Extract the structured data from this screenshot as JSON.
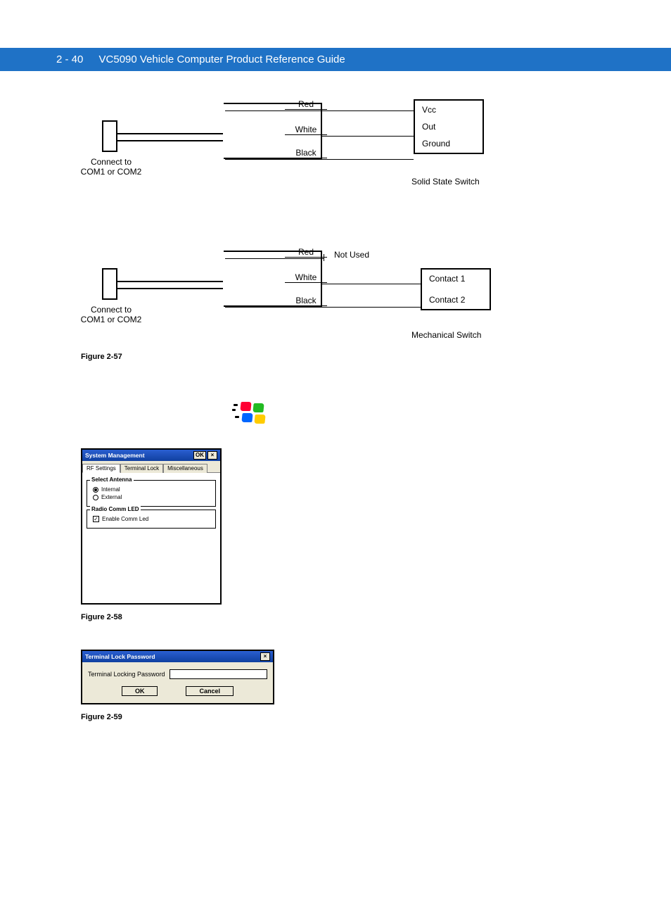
{
  "header": {
    "page_num": "2 - 40",
    "title": "VC5090 Vehicle Computer Product Reference Guide"
  },
  "diagram1": {
    "connect_label": "Connect to\nCOM1 or COM2",
    "wires": {
      "red": "Red",
      "white": "White",
      "black": "Black"
    },
    "box": {
      "line1": "Vcc",
      "line2": "Out",
      "line3": "Ground"
    },
    "caption": "Solid State Switch"
  },
  "diagram2": {
    "connect_label": "Connect to\nCOM1 or COM2",
    "wires": {
      "red": "Red",
      "white": "White",
      "black": "Black"
    },
    "not_used": "Not Used",
    "box": {
      "line1": "Contact 1",
      "line2": "Contact 2"
    },
    "caption": "Mechanical Switch"
  },
  "fig57": "Figure 2-57",
  "sys_mgmt": {
    "title": "System Management",
    "ok": "OK",
    "tabs": {
      "rf": "RF Settings",
      "lock": "Terminal Lock",
      "misc": "Miscellaneous"
    },
    "antenna": {
      "legend": "Select Antenna",
      "internal": "Internal",
      "external": "External"
    },
    "led": {
      "legend": "Radio Comm LED",
      "enable": "Enable Comm Led"
    }
  },
  "fig58": "Figure 2-58",
  "pw_dlg": {
    "title": "Terminal Lock Password",
    "label": "Terminal Locking Password",
    "ok": "OK",
    "cancel": "Cancel"
  },
  "fig59": "Figure 2-59"
}
